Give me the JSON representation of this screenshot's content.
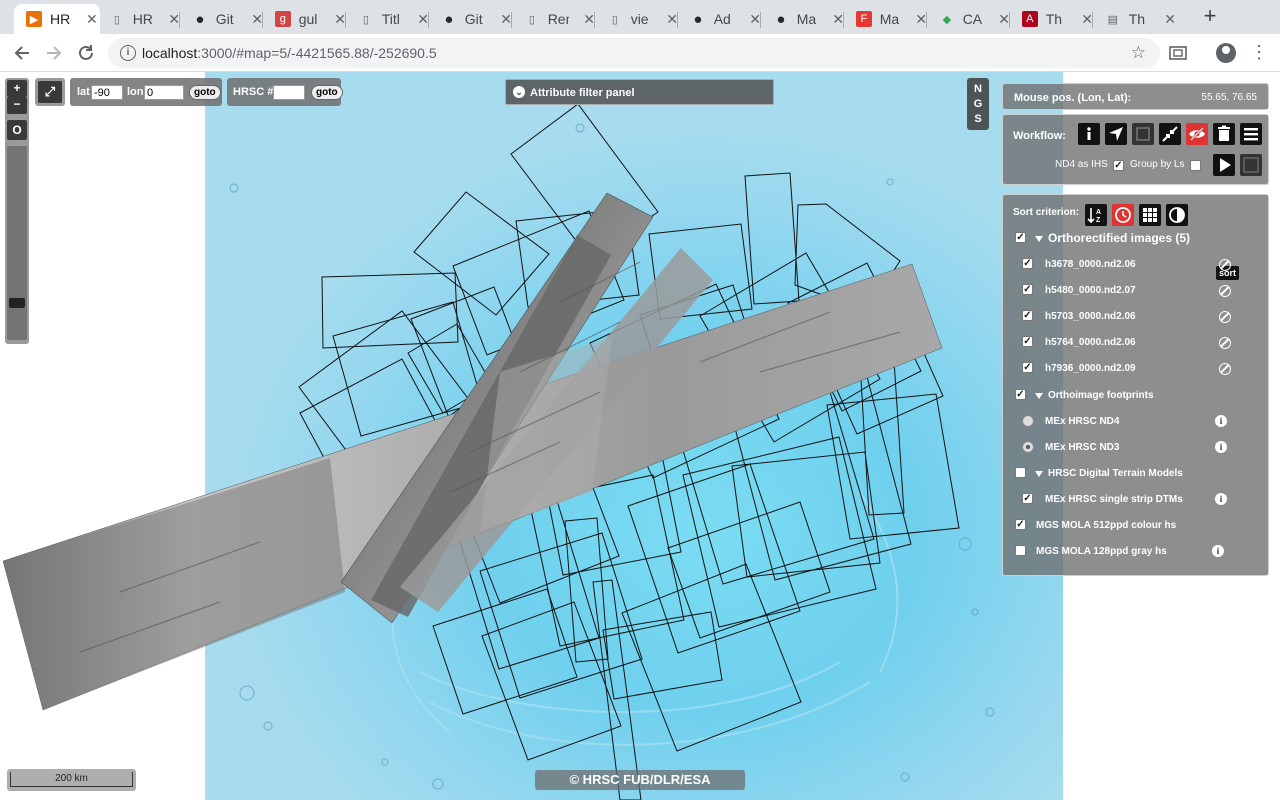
{
  "browser": {
    "tabs": [
      {
        "title": "HR",
        "favicon": "play-icon",
        "color": "#e8710a",
        "active": true
      },
      {
        "title": "HR",
        "favicon": "doc-icon"
      },
      {
        "title": "Git",
        "favicon": "github-icon"
      },
      {
        "title": "gul",
        "favicon": "gulp-icon",
        "color": "#cf4647"
      },
      {
        "title": "Titl",
        "favicon": "doc-icon"
      },
      {
        "title": "Git",
        "favicon": "github-icon"
      },
      {
        "title": "Rer",
        "favicon": "doc-icon"
      },
      {
        "title": "vie",
        "favicon": "doc-icon"
      },
      {
        "title": "Ad",
        "favicon": "github-icon"
      },
      {
        "title": "Ma",
        "favicon": "github-icon"
      },
      {
        "title": "Ma",
        "favicon": "f-icon",
        "color": "#e53935"
      },
      {
        "title": "CA",
        "favicon": "maps-icon"
      },
      {
        "title": "Th",
        "favicon": "arizona-icon",
        "color": "#ab0520"
      },
      {
        "title": "Th",
        "favicon": "flag-icon"
      }
    ],
    "new_tab": "+",
    "url_host": "localhost",
    "url_rest": ":3000/#map=5/-4421565.88/-252690.5"
  },
  "map": {
    "zoom_in": "+",
    "zoom_out": "−",
    "reset": "O",
    "fullscreen": "⤢",
    "lat_label": "lat",
    "lat_value": "-90",
    "lon_label": "lon",
    "lon_value": "0",
    "goto": "goto",
    "hrsc_label": "HRSC #",
    "hrsc_value": "",
    "attribute_filter": "Attribute filter panel",
    "ngs": [
      "N",
      "G",
      "S"
    ],
    "scale": "200 km",
    "attribution": "© HRSC FUB/DLR/ESA",
    "colors": {
      "sea": "#79d0ec",
      "deep": "#5bc5e8",
      "highland": "#a9dcef",
      "strip": "#8a8a8a"
    }
  },
  "mouse": {
    "label": "Mouse pos. (Lon, Lat):",
    "value": "55.65, 76.65"
  },
  "workflow": {
    "label": "Workflow:",
    "buttons": [
      "info-icon",
      "locate-icon",
      "select-box-icon",
      "shrink-icon",
      "hide-icon",
      "trash-icon",
      "menu-icon"
    ],
    "nd4_label": "ND4 as IHS",
    "nd4_checked": true,
    "group_label": "Group by Ls",
    "group_checked": false
  },
  "layers": {
    "sort_label": "Sort criterion:",
    "sort_button": "sort",
    "ortho_group": "Orthorectified images (5)",
    "images": [
      "h3678_0000.nd2.06",
      "h5480_0000.nd2.07",
      "h5703_0000.nd2.06",
      "h5764_0000.nd2.06",
      "h7936_0000.nd2.09"
    ],
    "footprints_group": "Orthoimage footprints",
    "footprints": [
      "MEx HRSC ND4",
      "MEx HRSC ND3"
    ],
    "dtm_group": "HRSC Digital Terrain Models",
    "dtm_item": "MEx HRSC single strip DTMs",
    "mola_colour": "MGS MOLA 512ppd colour hs",
    "mola_gray": "MGS MOLA 128ppd gray hs"
  }
}
